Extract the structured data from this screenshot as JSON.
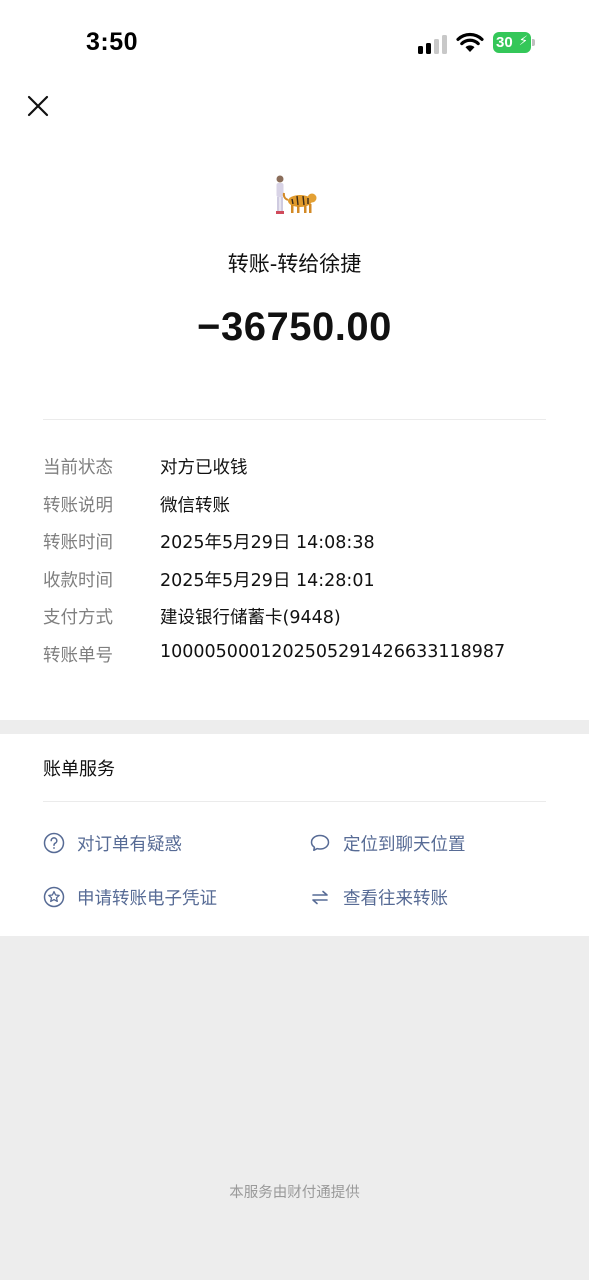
{
  "status_bar": {
    "time": "3:50",
    "battery": "30"
  },
  "transaction": {
    "title": "转账-转给徐捷",
    "amount": "−36750.00"
  },
  "details": [
    {
      "label": "当前状态",
      "value": "对方已收钱"
    },
    {
      "label": "转账说明",
      "value": "微信转账"
    },
    {
      "label": "转账时间",
      "value": "2025年5月29日 14:08:38"
    },
    {
      "label": "收款时间",
      "value": "2025年5月29日 14:28:01"
    },
    {
      "label": "支付方式",
      "value": "建设银行储蓄卡(9448)"
    },
    {
      "label": "转账单号",
      "value": "1000050001202505291426633118987"
    }
  ],
  "services": {
    "title": "账单服务",
    "items": [
      {
        "label": "对订单有疑惑",
        "icon": "question-circle-icon"
      },
      {
        "label": "定位到聊天位置",
        "icon": "chat-bubble-icon"
      },
      {
        "label": "申请转账电子凭证",
        "icon": "star-badge-icon"
      },
      {
        "label": "查看往来转账",
        "icon": "exchange-arrows-icon"
      }
    ]
  },
  "footer": "本服务由财付通提供",
  "colors": {
    "link": "#576b95",
    "label_gray": "#7f7f7f",
    "background": "#ededed",
    "battery": "#34c759"
  }
}
